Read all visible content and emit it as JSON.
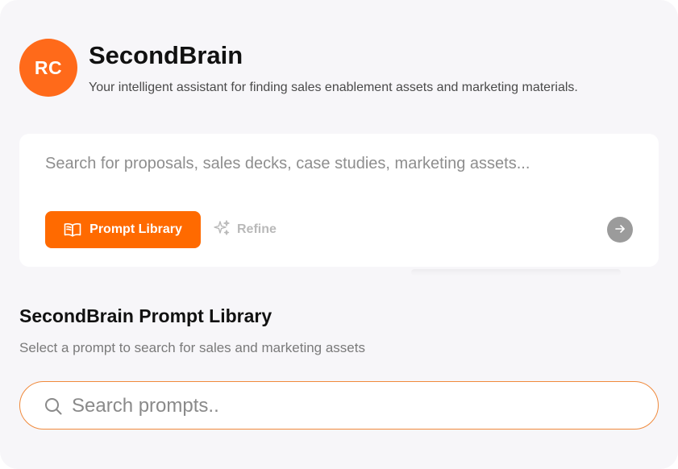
{
  "header": {
    "avatar_initials": "RC",
    "app_name": "SecondBrain",
    "tagline": "Your intelligent assistant for finding sales enablement assets and marketing materials."
  },
  "search": {
    "placeholder": "Search for proposals, sales decks, case studies, marketing assets...",
    "value": "",
    "prompt_library_label": "Prompt Library",
    "refine_label": "Refine",
    "send_icon": "arrow-right-icon"
  },
  "prompt_library": {
    "title": "SecondBrain Prompt Library",
    "subtitle": "Select a prompt to search for sales and marketing assets",
    "search_placeholder": "Search prompts..",
    "search_value": ""
  },
  "colors": {
    "accent": "#ff6a00",
    "avatar": "#ff6a1a",
    "background": "#f7f6f9",
    "disabled": "#9b9b9b"
  }
}
